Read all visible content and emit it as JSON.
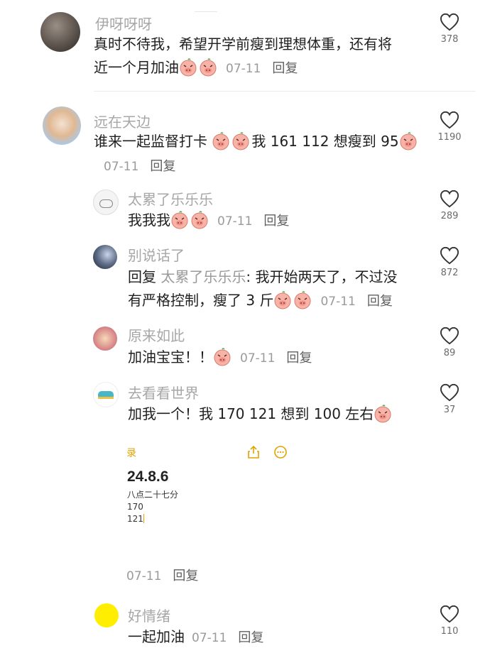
{
  "comments": [
    {
      "name": "伊呀呀呀",
      "text_line1": "真时不待我，希望开学前瘦到理想体重，还有将",
      "text_line2": "近一个月加油",
      "date": "07-11",
      "reply": "回复",
      "likes": "378"
    },
    {
      "name": "远在天边",
      "text_a": "谁来一起监督打卡",
      "text_b": "我 161 112 想瘦到 95",
      "date": "07-11",
      "reply": "回复",
      "likes": "1190",
      "replies": [
        {
          "name": "太累了乐乐乐",
          "text": "我我我",
          "date": "07-11",
          "reply": "回复",
          "likes": "289"
        },
        {
          "name": "别说话了",
          "reply_prefix": "回复",
          "mention": "太累了乐乐乐",
          "text_line1": ": 我开始两天了，不过没",
          "text_line2": "有严格控制，瘦了 3 斤",
          "date": "07-11",
          "reply": "回复",
          "likes": "872"
        },
        {
          "name": "原来如此",
          "text": "加油宝宝！！",
          "date": "07-11",
          "reply": "回复",
          "likes": "89"
        },
        {
          "name": "去看看世界",
          "text": "加我一个！我 170 121 想到 100 左右",
          "likes": "37",
          "date": "07-11",
          "reply": "回复",
          "note_image": {
            "toolbar_label": "录",
            "title": "24.8.6",
            "line1": "八点二十七分",
            "line2": "170",
            "line3": "121"
          }
        }
      ]
    },
    {
      "name": "好情绪",
      "text": "一起加油",
      "date": "07-11",
      "reply": "回复",
      "likes": "110"
    }
  ],
  "icons": {
    "like": "heart-outline-icon",
    "emoji": "pig-face-emoji",
    "share": "share-icon",
    "more": "more-circle-icon"
  },
  "colors": {
    "name": "#a7a7a7",
    "meta": "#9a9a9a",
    "note_accent": "#e0a400",
    "avatar_yellow": "#ffee00"
  }
}
